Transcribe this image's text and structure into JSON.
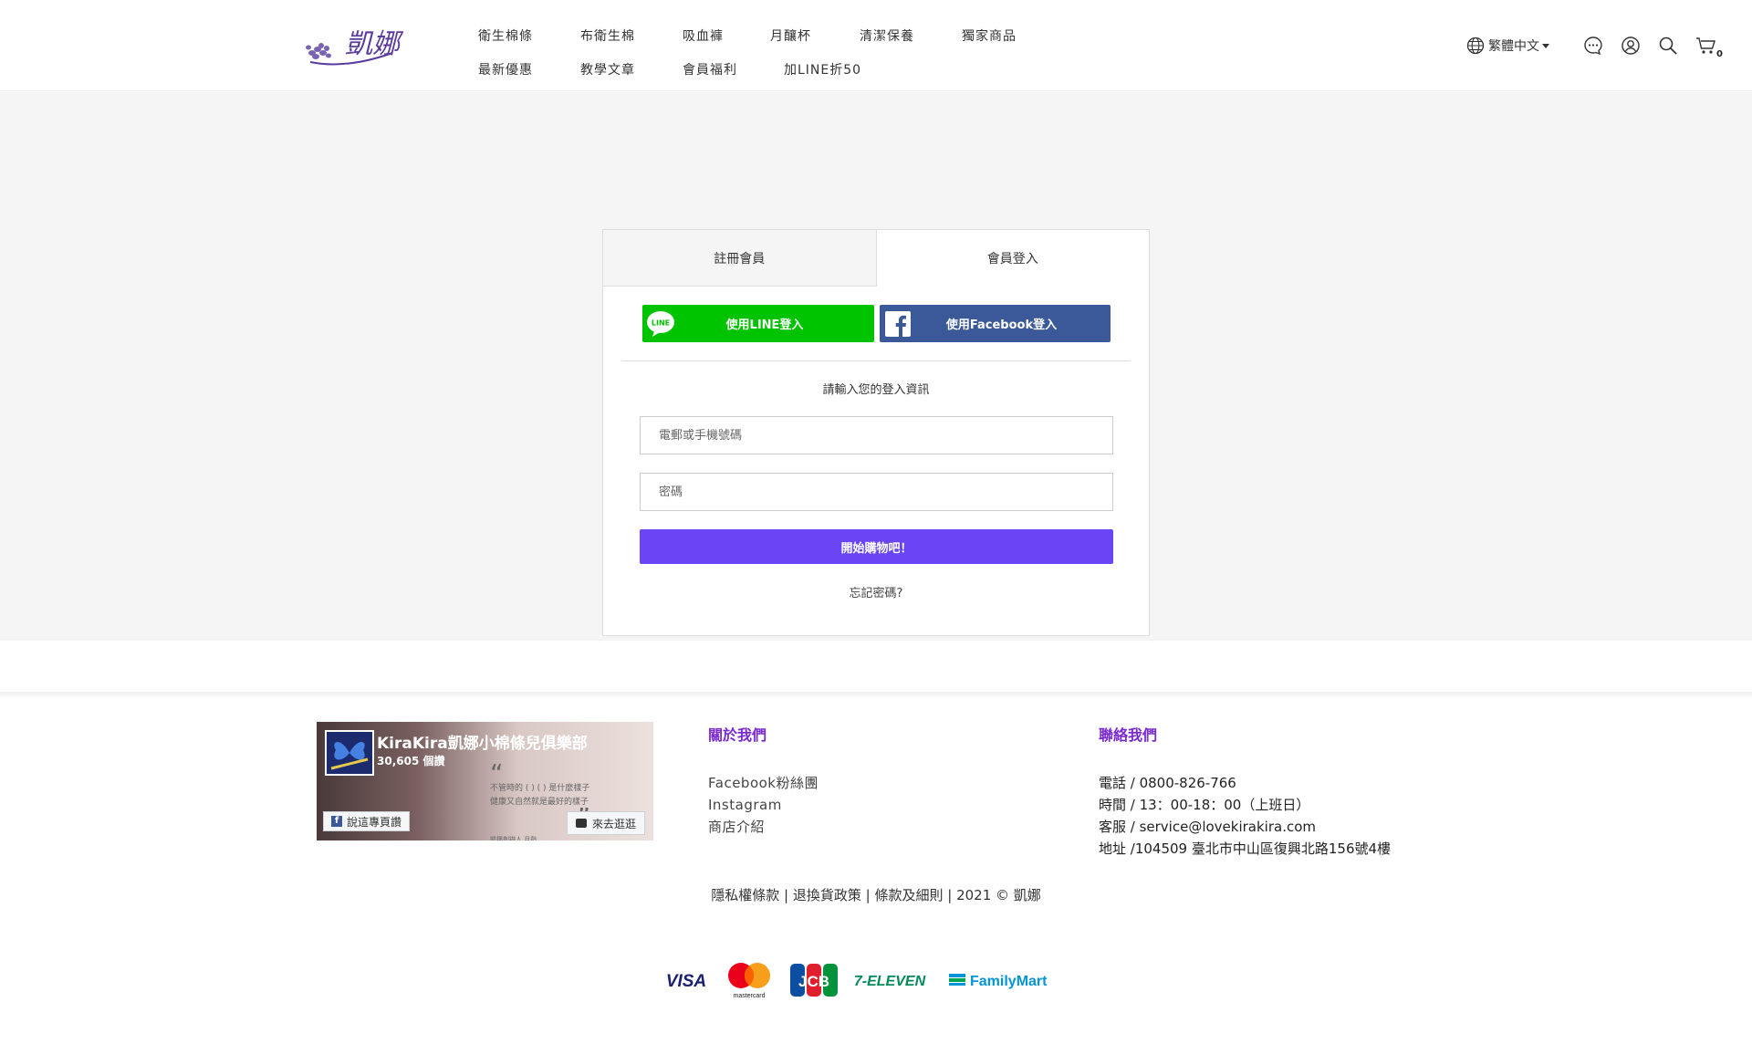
{
  "header": {
    "logo_text": "凱娜",
    "nav_row1": [
      "衛生棉條",
      "布衛生棉",
      "吸血褲",
      "月釀杯",
      "清潔保養",
      "獨家商品"
    ],
    "nav_row2": [
      "最新優惠",
      "教學文章",
      "會員福利",
      "加LINE折50"
    ],
    "language": "繁體中文",
    "cart_count": "0",
    "icons": [
      "globe-icon",
      "chat-icon",
      "user-icon",
      "search-icon",
      "cart-icon"
    ]
  },
  "login": {
    "tab_register": "註冊會員",
    "tab_login": "會員登入",
    "line_button": "使用LINE登入",
    "line_icon_text": "LINE",
    "facebook_button": "使用Facebook登入",
    "prompt": "請輸入您的登入資訊",
    "email_placeholder": "電郵或手機號碼",
    "password_placeholder": "密碼",
    "submit": "開始購物吧！",
    "forgot": "忘記密碼?"
  },
  "footer": {
    "fb_widget": {
      "page_name": "KiraKira凱娜小棉條兒俱樂部",
      "likes": "30,605 個讚",
      "quote_line1": "不管時的 ( ) ( ) 是什麼樣子",
      "quote_line2": "健康又自然就是最好的樣子",
      "quote_signature": "凱娜創辦人 月齡",
      "like_button": "說這專頁讚",
      "visit_button": "來去逛逛"
    },
    "about": {
      "heading": "關於我們",
      "links": [
        "Facebook粉絲團",
        "Instagram",
        "商店介紹"
      ]
    },
    "contact": {
      "heading": "聯絡我們",
      "phone": "電話 / 0800-826-766",
      "hours": "時間 / 13：00-18：00（上班日）",
      "email": "客服 / service@lovekirakira.com",
      "address": "地址 /104509 臺北市中山區復興北路156號4樓"
    },
    "legal": {
      "privacy": "隱私權條款",
      "returns": "退換貨政策",
      "terms": "條款及細則",
      "copyright": "2021 © 凱娜"
    },
    "payments": {
      "visa": "VISA",
      "mastercard": "mastercard",
      "jcb": "JCB",
      "seven": "7-ELEVEN",
      "familymart": "FamilyMart"
    }
  },
  "colors": {
    "brand_purple": "#6a45f5",
    "heading_purple": "#7b2ad0",
    "line_green": "#00c300",
    "facebook_blue": "#3b5998"
  }
}
